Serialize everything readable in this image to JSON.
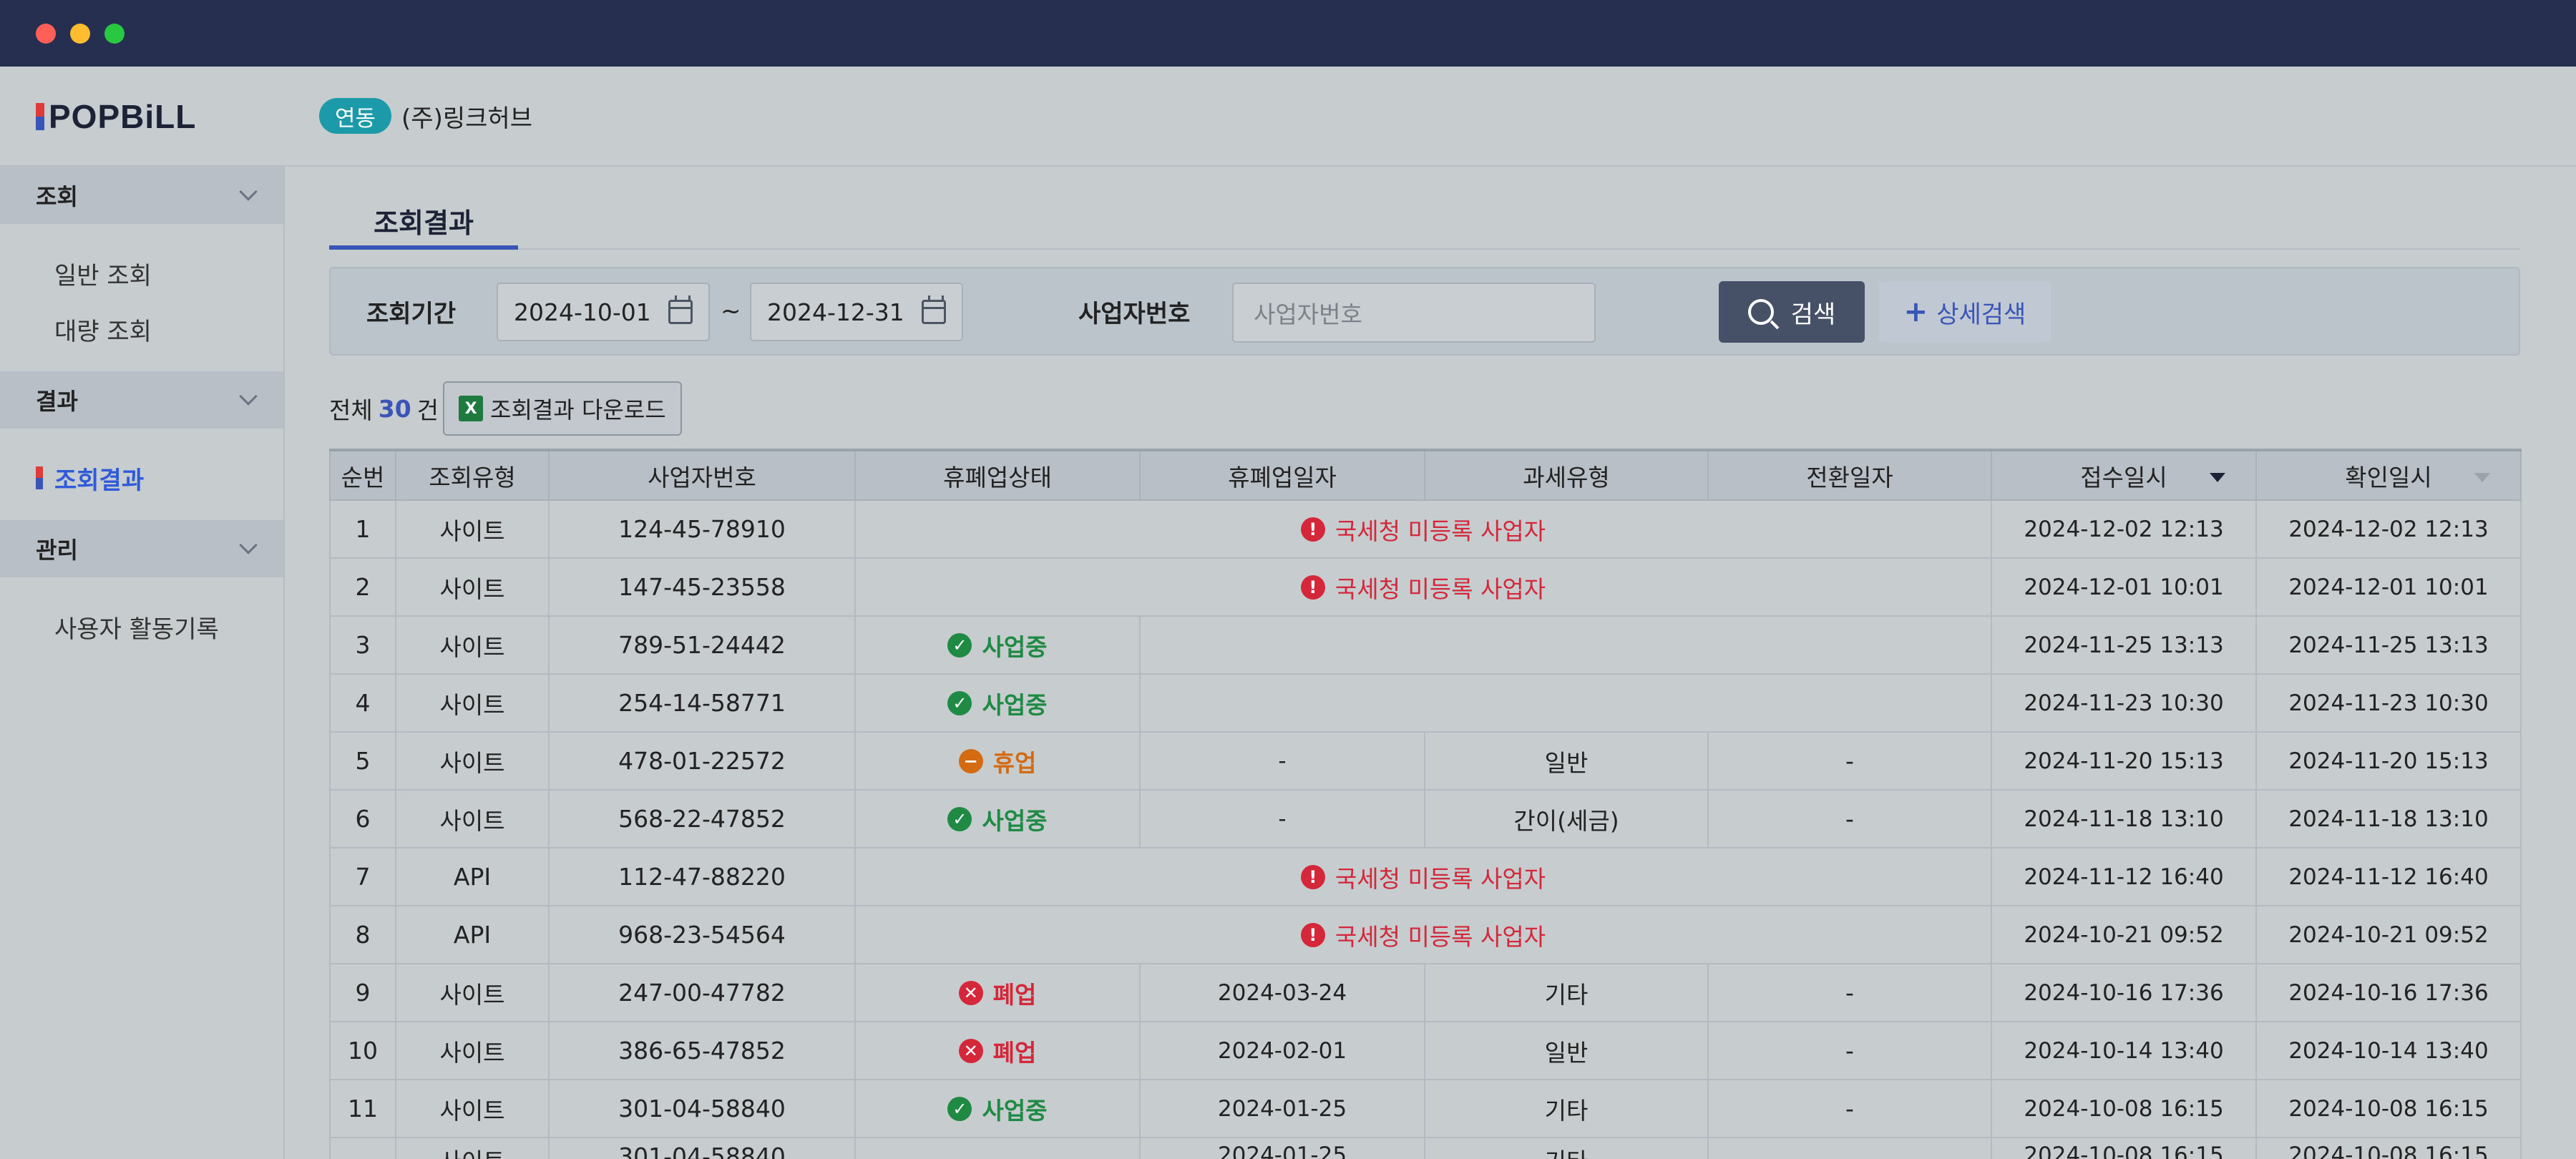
{
  "app": {
    "logo_text": "POPBiLL",
    "link_badge": "연동",
    "company_name": "(주)링크허브"
  },
  "sidebar": {
    "groups": [
      {
        "label": "조회",
        "items": [
          {
            "label": "일반 조회"
          },
          {
            "label": "대량 조회"
          }
        ]
      },
      {
        "label": "결과",
        "items": [
          {
            "label": "조회결과",
            "active": true
          }
        ]
      },
      {
        "label": "관리",
        "items": [
          {
            "label": "사용자 활동기록"
          }
        ]
      }
    ]
  },
  "main": {
    "tab_label": "조회결과",
    "filter": {
      "period_label": "조회기간",
      "date_from": "2024-10-01",
      "separator": "~",
      "date_to": "2024-12-31",
      "biz_label": "사업자번호",
      "biz_placeholder": "사업자번호",
      "search_button": "검색",
      "advanced_button": "상세검색"
    },
    "summary": {
      "prefix": "전체",
      "count": "30",
      "suffix": "건",
      "download_button": "조회결과 다운로드",
      "excel_icon_text": "X"
    },
    "table": {
      "headers": [
        "순번",
        "조회유형",
        "사업자번호",
        "휴폐업상태",
        "휴폐업일자",
        "과세유형",
        "전환일자",
        "접수일시",
        "확인일시"
      ],
      "status_labels": {
        "active": "사업중",
        "suspended": "휴업",
        "closed": "폐업",
        "not_registered": "국세청 미등록 사업자"
      },
      "rows": [
        {
          "no": "1",
          "type": "사이트",
          "biz_no": "124-45-78910",
          "status": "not_registered",
          "closure_date": "",
          "tax_type": "",
          "conversion_date": "",
          "received_at": "2024-12-02 12:13",
          "confirmed_at": "2024-12-02 12:13"
        },
        {
          "no": "2",
          "type": "사이트",
          "biz_no": "147-45-23558",
          "status": "not_registered",
          "closure_date": "",
          "tax_type": "",
          "conversion_date": "",
          "received_at": "2024-12-01 10:01",
          "confirmed_at": "2024-12-01 10:01"
        },
        {
          "no": "3",
          "type": "사이트",
          "biz_no": "789-51-24442",
          "status": "active",
          "closure_date": "",
          "tax_type": "",
          "conversion_date": "",
          "received_at": "2024-11-25 13:13",
          "confirmed_at": "2024-11-25 13:13"
        },
        {
          "no": "4",
          "type": "사이트",
          "biz_no": "254-14-58771",
          "status": "active",
          "closure_date": "",
          "tax_type": "",
          "conversion_date": "",
          "received_at": "2024-11-23 10:30",
          "confirmed_at": "2024-11-23 10:30"
        },
        {
          "no": "5",
          "type": "사이트",
          "biz_no": "478-01-22572",
          "status": "suspended",
          "closure_date": "-",
          "tax_type": "일반",
          "conversion_date": "-",
          "received_at": "2024-11-20 15:13",
          "confirmed_at": "2024-11-20 15:13"
        },
        {
          "no": "6",
          "type": "사이트",
          "biz_no": "568-22-47852",
          "status": "active",
          "closure_date": "-",
          "tax_type": "간이(세금)",
          "conversion_date": "-",
          "received_at": "2024-11-18 13:10",
          "confirmed_at": "2024-11-18 13:10"
        },
        {
          "no": "7",
          "type": "API",
          "biz_no": "112-47-88220",
          "status": "not_registered",
          "closure_date": "",
          "tax_type": "",
          "conversion_date": "",
          "received_at": "2024-11-12 16:40",
          "confirmed_at": "2024-11-12 16:40"
        },
        {
          "no": "8",
          "type": "API",
          "biz_no": "968-23-54564",
          "status": "not_registered",
          "closure_date": "",
          "tax_type": "",
          "conversion_date": "",
          "received_at": "2024-10-21 09:52",
          "confirmed_at": "2024-10-21 09:52"
        },
        {
          "no": "9",
          "type": "사이트",
          "biz_no": "247-00-47782",
          "status": "closed",
          "closure_date": "2024-03-24",
          "tax_type": "기타",
          "conversion_date": "-",
          "received_at": "2024-10-16 17:36",
          "confirmed_at": "2024-10-16 17:36"
        },
        {
          "no": "10",
          "type": "사이트",
          "biz_no": "386-65-47852",
          "status": "closed",
          "closure_date": "2024-02-01",
          "tax_type": "일반",
          "conversion_date": "-",
          "received_at": "2024-10-14 13:40",
          "confirmed_at": "2024-10-14 13:40"
        },
        {
          "no": "11",
          "type": "사이트",
          "biz_no": "301-04-58840",
          "status": "active",
          "closure_date": "2024-01-25",
          "tax_type": "기타",
          "conversion_date": "-",
          "received_at": "2024-10-08 16:15",
          "confirmed_at": "2024-10-08 16:15"
        },
        {
          "no": "",
          "type": "사이트",
          "biz_no": "301-04-58840",
          "status": "",
          "closure_date": "2024-01-25",
          "tax_type": "기타",
          "conversion_date": "",
          "received_at": "2024-10-08 16:15",
          "confirmed_at": "2024-10-08 16:15"
        }
      ]
    }
  },
  "colors": {
    "titlebar": "#262f4f",
    "accent": "#3a55b8",
    "badge": "#1d9aa9",
    "error_red": "#d4283a",
    "ok_green": "#1e8a44",
    "warn_orange": "#d46a12"
  },
  "icons": {
    "calendar": "calendar-icon",
    "search": "search-icon",
    "excel": "excel-icon",
    "check": "check-circle-icon",
    "minus": "minus-circle-icon",
    "x": "x-circle-icon",
    "alert": "exclamation-circle-icon"
  }
}
